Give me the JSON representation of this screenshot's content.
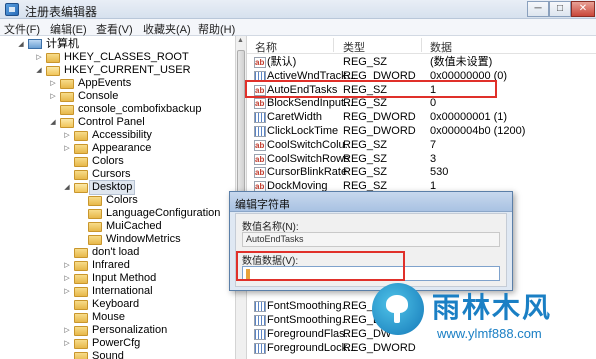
{
  "window": {
    "title": "注册表编辑器",
    "min": "─",
    "max": "□",
    "close": "✕"
  },
  "menu": [
    "文件(F)",
    "编辑(E)",
    "查看(V)",
    "收藏夹(A)",
    "帮助(H)"
  ],
  "tree": [
    {
      "label": "计算机",
      "arrow": "◢",
      "kind": "pc"
    },
    {
      "label": "HKEY_CLASSES_ROOT",
      "arrow": "▷",
      "kind": "folder"
    },
    {
      "label": "HKEY_CURRENT_USER",
      "arrow": "◢",
      "kind": "open"
    },
    {
      "label": "AppEvents",
      "arrow": "▷",
      "kind": "folder"
    },
    {
      "label": "Console",
      "arrow": "▷",
      "kind": "folder"
    },
    {
      "label": "console_combofixbackup",
      "arrow": "",
      "kind": "folder"
    },
    {
      "label": "Control Panel",
      "arrow": "◢",
      "kind": "open"
    },
    {
      "label": "Accessibility",
      "arrow": "▷",
      "kind": "folder"
    },
    {
      "label": "Appearance",
      "arrow": "▷",
      "kind": "folder"
    },
    {
      "label": "Colors",
      "arrow": "",
      "kind": "folder"
    },
    {
      "label": "Cursors",
      "arrow": "",
      "kind": "folder"
    },
    {
      "label": "Desktop",
      "arrow": "◢",
      "kind": "open"
    },
    {
      "label": "Colors",
      "arrow": "",
      "kind": "folder"
    },
    {
      "label": "LanguageConfiguration",
      "arrow": "",
      "kind": "folder"
    },
    {
      "label": "MuiCached",
      "arrow": "",
      "kind": "folder"
    },
    {
      "label": "WindowMetrics",
      "arrow": "",
      "kind": "folder"
    },
    {
      "label": "don't load",
      "arrow": "",
      "kind": "folder"
    },
    {
      "label": "Infrared",
      "arrow": "▷",
      "kind": "folder"
    },
    {
      "label": "Input Method",
      "arrow": "▷",
      "kind": "folder"
    },
    {
      "label": "International",
      "arrow": "▷",
      "kind": "folder"
    },
    {
      "label": "Keyboard",
      "arrow": "",
      "kind": "folder"
    },
    {
      "label": "Mouse",
      "arrow": "",
      "kind": "folder"
    },
    {
      "label": "Personalization",
      "arrow": "▷",
      "kind": "folder"
    },
    {
      "label": "PowerCfg",
      "arrow": "▷",
      "kind": "folder"
    },
    {
      "label": "Sound",
      "arrow": "",
      "kind": "folder"
    }
  ],
  "columns": {
    "name": "名称",
    "type": "类型",
    "data": "数据"
  },
  "values": [
    {
      "name": "(默认)",
      "type": "REG_SZ",
      "data": "(数值未设置)",
      "icon": "sz"
    },
    {
      "name": "ActiveWndTrack...",
      "type": "REG_DWORD",
      "data": "0x00000000 (0)",
      "icon": "dword"
    },
    {
      "name": "AutoEndTasks",
      "type": "REG_SZ",
      "data": "1",
      "icon": "sz"
    },
    {
      "name": "BlockSendInput...",
      "type": "REG_SZ",
      "data": "0",
      "icon": "sz"
    },
    {
      "name": "CaretWidth",
      "type": "REG_DWORD",
      "data": "0x00000001 (1)",
      "icon": "dword"
    },
    {
      "name": "ClickLockTime",
      "type": "REG_DWORD",
      "data": "0x000004b0 (1200)",
      "icon": "dword"
    },
    {
      "name": "CoolSwitchColu...",
      "type": "REG_SZ",
      "data": "7",
      "icon": "sz"
    },
    {
      "name": "CoolSwitchRows",
      "type": "REG_SZ",
      "data": "3",
      "icon": "sz"
    },
    {
      "name": "CursorBlinkRate",
      "type": "REG_SZ",
      "data": "530",
      "icon": "sz"
    },
    {
      "name": "DockMoving",
      "type": "REG_SZ",
      "data": "1",
      "icon": "sz"
    }
  ],
  "values_bottom": [
    {
      "name": "FontSmoothing...",
      "type": "REG_DW",
      "icon": "dword"
    },
    {
      "name": "FontSmoothing...",
      "type": "REG_DW",
      "icon": "dword"
    },
    {
      "name": "ForegroundFlas...",
      "type": "REG_DW",
      "icon": "dword"
    },
    {
      "name": "ForegroundLock...",
      "type": "REG_DWORD",
      "icon": "dword"
    }
  ],
  "dialog": {
    "title": "编辑字符串",
    "name_label": "数值名称(N):",
    "name_value": "AutoEndTasks",
    "data_label": "数值数据(V):",
    "data_value": ""
  },
  "watermark": {
    "title": "雨林木风",
    "url": "www.ylmf888.com"
  },
  "colors": {
    "highlight_box": "#e0302a",
    "watermark": "#1a7fc4"
  }
}
